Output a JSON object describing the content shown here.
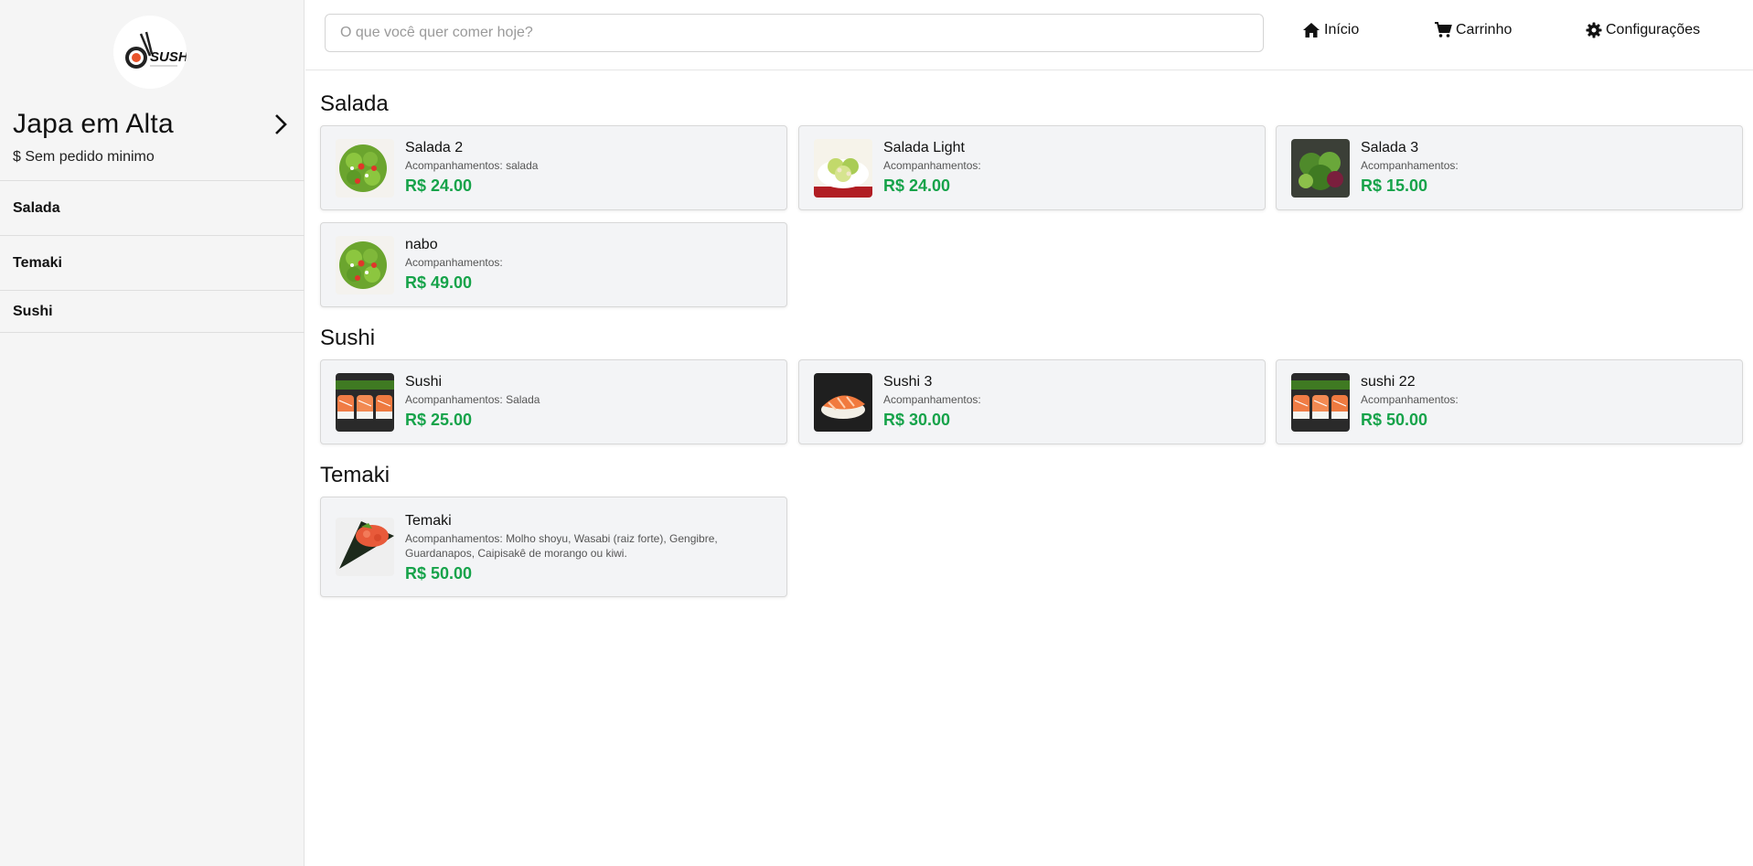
{
  "sidebar": {
    "logo_text": "SUSHI",
    "store_name": "Japa em Alta",
    "min_order": "$ Sem pedido minimo",
    "categories": [
      {
        "label": "Salada"
      },
      {
        "label": "Temaki"
      },
      {
        "label": "Sushi"
      }
    ]
  },
  "header": {
    "search_placeholder": "O que você quer comer hoje?",
    "nav": {
      "home": "Início",
      "cart": "Carrinho",
      "settings": "Configurações"
    }
  },
  "sections": [
    {
      "title": "Salada",
      "items": [
        {
          "name": "Salada 2",
          "accompaniments": "Acompanhamentos: salada",
          "price": "R$ 24.00",
          "image": "green-salad"
        },
        {
          "name": "Salada Light",
          "accompaniments": "Acompanhamentos:",
          "price": "R$ 24.00",
          "image": "caesar-salad"
        },
        {
          "name": "Salada 3",
          "accompaniments": "Acompanhamentos:",
          "price": "R$ 15.00",
          "image": "leafy-salad"
        },
        {
          "name": "nabo",
          "accompaniments": "Acompanhamentos:",
          "price": "R$ 49.00",
          "image": "green-salad"
        }
      ]
    },
    {
      "title": "Sushi",
      "items": [
        {
          "name": "Sushi",
          "accompaniments": "Acompanhamentos: Salada",
          "price": "R$ 25.00",
          "image": "sushi-platter"
        },
        {
          "name": "Sushi 3",
          "accompaniments": "Acompanhamentos:",
          "price": "R$ 30.00",
          "image": "salmon-nigiri"
        },
        {
          "name": "sushi 22",
          "accompaniments": "Acompanhamentos:",
          "price": "R$ 50.00",
          "image": "sushi-platter"
        }
      ]
    },
    {
      "title": "Temaki",
      "items": [
        {
          "name": "Temaki",
          "accompaniments": "Acompanhamentos: Molho shoyu, Wasabi (raiz forte), Gengibre, Guardanapos, Caipisakê de morango ou kiwi.",
          "price": "R$ 50.00",
          "image": "temaki-cone"
        }
      ]
    }
  ],
  "colors": {
    "price": "#16a34a",
    "sidebar_bg": "#f5f5f5",
    "card_bg": "#f3f4f6"
  }
}
